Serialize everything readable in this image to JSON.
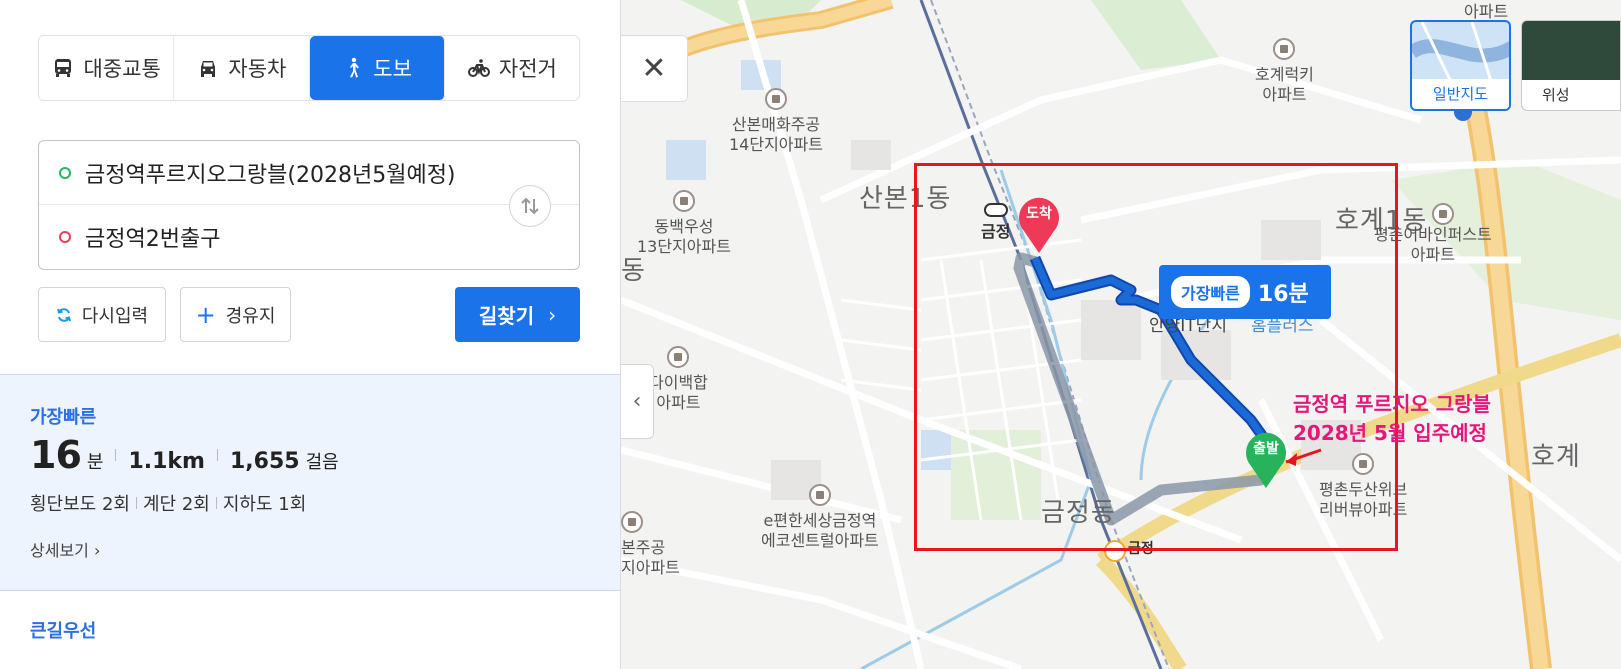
{
  "modes": [
    {
      "label": "대중교통",
      "icon": "bus-icon",
      "active": false
    },
    {
      "label": "자동차",
      "icon": "car-icon",
      "active": false
    },
    {
      "label": "도보",
      "icon": "walk-icon",
      "active": true
    },
    {
      "label": "자전거",
      "icon": "bicycle-icon",
      "active": false
    }
  ],
  "route": {
    "origin": "금정역푸르지오그랑블(2028년5월예정)",
    "destination": "금정역2번출구"
  },
  "actions": {
    "reset": "다시입력",
    "waypoint": "경유지",
    "search": "길찾기"
  },
  "results": [
    {
      "label": "가장빠른",
      "minutes": "16",
      "minutes_unit": "분",
      "distance": "1.1km",
      "steps": "1,655",
      "steps_unit": "걸음",
      "details": [
        "횡단보도 2회",
        "계단 2회",
        "지하도 1회"
      ],
      "more": "상세보기"
    },
    {
      "label": "큰길우선"
    }
  ],
  "map": {
    "dongs": [
      "산본1동",
      "호계1동",
      "금정동",
      "호계"
    ],
    "dong_fragment": "동",
    "station": "금정",
    "ic_label": "금정",
    "pois": [
      "산본매화주공\n14단지아파트",
      "호계럭키\n아파트",
      "동백우성\n13단지아파트",
      "평촌어바인퍼스트\n아파트",
      "안양IT단지",
      "홈플러스",
      "다이백합\n아파트",
      "평촌두산위브\n리버뷰아파트",
      "e편한세상금정역\n에코센트럴아파트",
      "본주공\n지아파트",
      "아파트"
    ],
    "time_tag": "가장빠른",
    "time_value": "16분",
    "pin_start": "출발",
    "pin_end": "도착",
    "annotation": [
      "금정역 푸르지오 그랑블",
      "2028년 5월 입주예정"
    ],
    "maptype_normal": "일반지도",
    "maptype_satellite": "위성",
    "colors": {
      "route": "#1a6ad8",
      "annotation": "#e4177b",
      "box": "#e8141e",
      "start_pin": "#27b35c",
      "end_pin": "#ee3a57"
    }
  }
}
